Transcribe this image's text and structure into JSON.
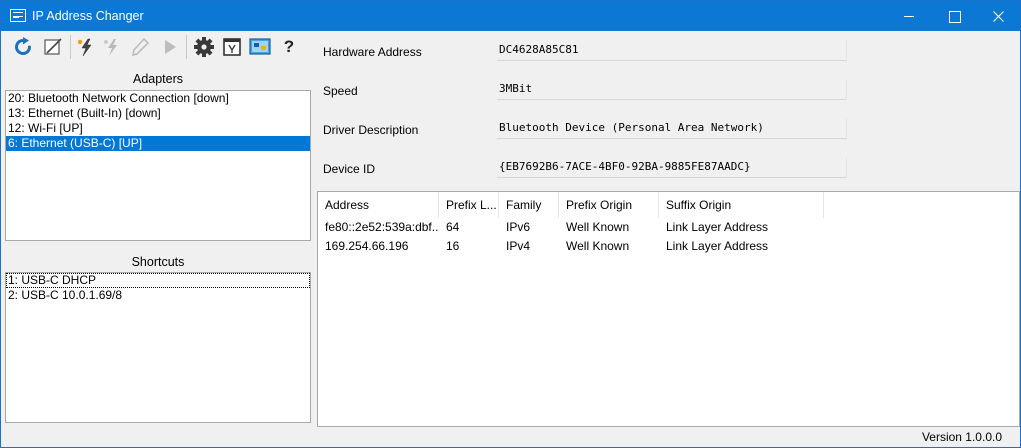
{
  "window": {
    "title": "IP Address Changer",
    "icon": "network-card-icon",
    "accent_color": "#0a78d4"
  },
  "toolbar": {
    "buttons": [
      {
        "name": "refresh",
        "icon": "refresh-icon",
        "enabled": true
      },
      {
        "name": "edit",
        "icon": "edit-icon",
        "enabled": true
      },
      {
        "name": "apply-shortcut",
        "icon": "lightning-icon",
        "enabled": true
      },
      {
        "name": "apply-shortcut-disabled",
        "icon": "lightning-disabled-icon",
        "enabled": false
      },
      {
        "name": "pencil",
        "icon": "pencil-icon",
        "enabled": false
      },
      {
        "name": "run",
        "icon": "play-icon",
        "enabled": false
      },
      {
        "name": "settings",
        "icon": "gear-icon",
        "enabled": true
      },
      {
        "name": "properties",
        "icon": "properties-icon",
        "enabled": true
      },
      {
        "name": "network-connections",
        "icon": "network-connections-icon",
        "enabled": true
      },
      {
        "name": "help",
        "icon": "help-icon",
        "enabled": true
      }
    ],
    "help_glyph": "?"
  },
  "adapters": {
    "label": "Adapters",
    "items": [
      {
        "label": "20: Bluetooth Network Connection [down]",
        "selected": false
      },
      {
        "label": "13: Ethernet (Built-In) [down]",
        "selected": false
      },
      {
        "label": "12: Wi-Fi [UP]",
        "selected": false
      },
      {
        "label": "6: Ethernet (USB-C) [UP]",
        "selected": true
      }
    ]
  },
  "shortcuts": {
    "label": "Shortcuts",
    "items": [
      {
        "label": "1: USB-C DHCP",
        "focused": true
      },
      {
        "label": "2: USB-C 10.0.1.69/8",
        "focused": false
      }
    ]
  },
  "properties": {
    "hardware_address": {
      "label": "Hardware Address",
      "value": "DC4628A85C81"
    },
    "speed": {
      "label": "Speed",
      "value": "3MBit"
    },
    "driver_description": {
      "label": "Driver Description",
      "value": "Bluetooth Device (Personal Area Network)"
    },
    "device_id": {
      "label": "Device ID",
      "value": "{EB7692B6-7ACE-4BF0-92BA-9885FE87AADC}"
    }
  },
  "addresses": {
    "columns": [
      "Address",
      "Prefix L...",
      "Family",
      "Prefix Origin",
      "Suffix Origin"
    ],
    "rows": [
      [
        "fe80::2e52:539a:dbf...",
        "64",
        "IPv6",
        "Well Known",
        "Link Layer Address"
      ],
      [
        "169.254.66.196",
        "16",
        "IPv4",
        "Well Known",
        "Link Layer Address"
      ]
    ]
  },
  "status": {
    "version": "Version 1.0.0.0"
  }
}
